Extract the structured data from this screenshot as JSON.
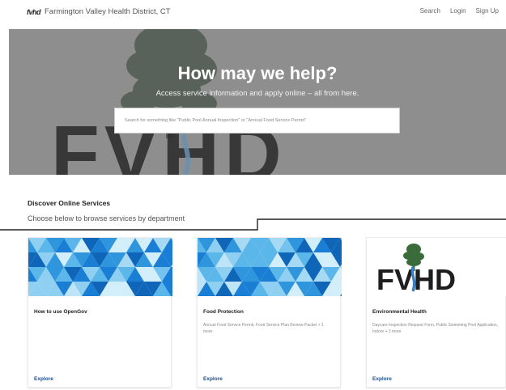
{
  "header": {
    "logo_mark": "fvhd",
    "site_title": "Farmington Valley Health District, CT",
    "nav": [
      "Search",
      "Login",
      "Sign Up"
    ]
  },
  "hero": {
    "title": "How may we help?",
    "subtitle": "Access service information and apply online – all from here.",
    "search_placeholder": "Search for something like \"Public Pool Annual Inspection\" or \"Annual Food Service Permit\"",
    "background_text": "FVHD"
  },
  "services": {
    "title": "Discover Online Services",
    "subtitle": "Choose below to browse services by department",
    "cards": [
      {
        "image": "blue-triangles-pattern",
        "title": "How to use OpenGov",
        "description": "",
        "link": "Explore"
      },
      {
        "image": "blue-triangles-pattern",
        "title": "Food Protection",
        "description": "Annual Food Service Permit, Food Service Plan Review Packet + 1 more",
        "link": "Explore"
      },
      {
        "image": "fvhd-logo",
        "logo_text": "FVHD",
        "title": "Environmental Health",
        "description": "Daycare Inspection Request Form, Public Swimming Pool Application, Indoor + 3 more",
        "link": "Explore"
      }
    ]
  },
  "colors": {
    "hero_bg": "#8c8c8c",
    "link": "#1a4e8a",
    "pattern_light": "#bfe4f7",
    "pattern_dark": "#1a7fd4"
  }
}
